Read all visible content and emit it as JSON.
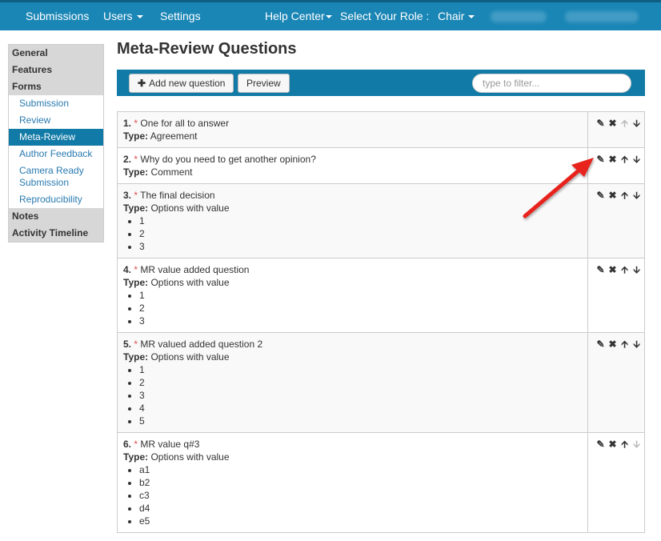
{
  "topnav": {
    "submissions": "Submissions",
    "users": "Users",
    "settings": "Settings",
    "help_center": "Help Center",
    "role_label": "Select Your Role :",
    "role": "Chair"
  },
  "sidebar": {
    "general": "General",
    "features": "Features",
    "forms": "Forms",
    "items": [
      {
        "label": "Submission",
        "active": false
      },
      {
        "label": "Review",
        "active": false
      },
      {
        "label": "Meta-Review",
        "active": true
      },
      {
        "label": "Author Feedback",
        "active": false
      },
      {
        "label": "Camera Ready Submission",
        "active": false
      },
      {
        "label": "Reproducibility",
        "active": false
      }
    ],
    "notes": "Notes",
    "activity": "Activity Timeline"
  },
  "page": {
    "title": "Meta-Review Questions",
    "add_button": "Add new question",
    "preview_button": "Preview",
    "filter_placeholder": "type to filter..."
  },
  "questions": [
    {
      "num": "1.",
      "req": "*",
      "text": "One for all to answer",
      "type_label": "Type:",
      "type": "Agreement",
      "options": [],
      "up_enabled": false,
      "down_enabled": true
    },
    {
      "num": "2.",
      "req": "*",
      "text": "Why do you need to get another opinion?",
      "type_label": "Type:",
      "type": "Comment",
      "options": [],
      "up_enabled": true,
      "down_enabled": true
    },
    {
      "num": "3.",
      "req": "*",
      "text": "The final decision",
      "type_label": "Type:",
      "type": "Options with value",
      "options": [
        "1",
        "2",
        "3"
      ],
      "up_enabled": true,
      "down_enabled": true
    },
    {
      "num": "4.",
      "req": "*",
      "text": "MR value added question",
      "type_label": "Type:",
      "type": "Options with value",
      "options": [
        "1",
        "2",
        "3"
      ],
      "up_enabled": true,
      "down_enabled": true
    },
    {
      "num": "5.",
      "req": "*",
      "text": "MR valued added question 2",
      "type_label": "Type:",
      "type": "Options with value",
      "options": [
        "1",
        "2",
        "3",
        "4",
        "5"
      ],
      "up_enabled": true,
      "down_enabled": true
    },
    {
      "num": "6.",
      "req": "*",
      "text": "MR value q#3",
      "type_label": "Type:",
      "type": "Options with value",
      "options": [
        "a1",
        "b2",
        "c3",
        "d4",
        "e5"
      ],
      "up_enabled": true,
      "down_enabled": false
    }
  ],
  "icons": {
    "edit": "edit-icon",
    "delete": "close-icon",
    "up": "arrow-up-icon",
    "down": "arrow-down-icon",
    "plus": "plus-icon"
  },
  "colors": {
    "nav_bg": "#1a86b5",
    "active_bg": "#117aa6",
    "toolbar_bg": "#117aa6",
    "required": "#d9534f",
    "annotation": "#e8201c"
  }
}
